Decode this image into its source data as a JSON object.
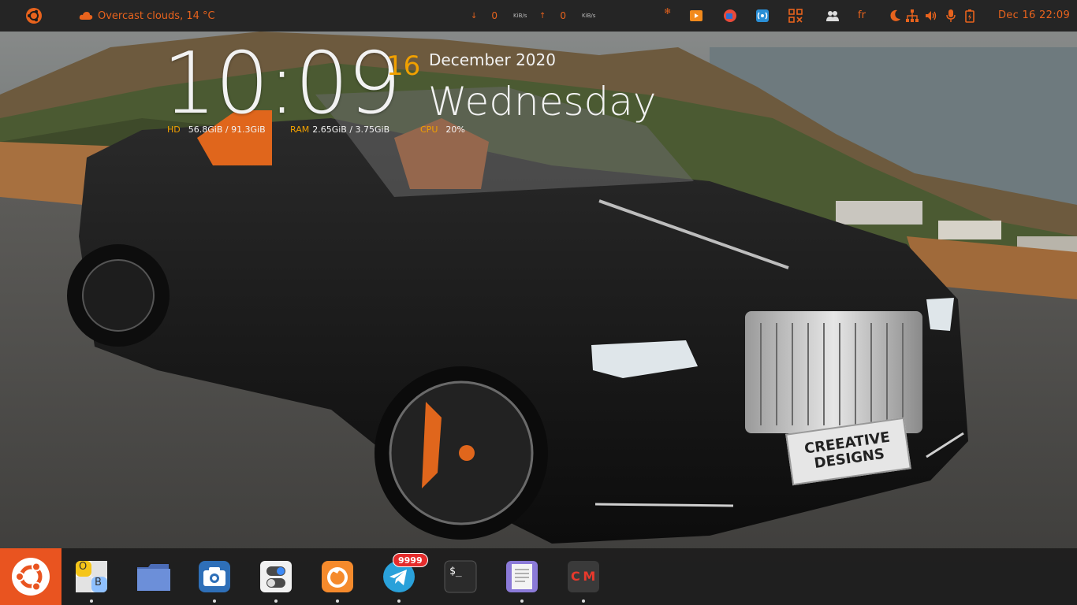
{
  "top_panel": {
    "weather_text": "Overcast clouds, 14 °C",
    "net_down_value": "0",
    "net_up_value": "0",
    "net_unit": "KiB/s",
    "language": "fr",
    "datetime": "Dec 16  22:09",
    "accent_color": "#e8631d",
    "icons": [
      "ubuntu-logo-icon",
      "weather-cloud-icon",
      "download-arrow-icon",
      "upload-arrow-icon",
      "snowflake-icon",
      "media-player-icon",
      "app-indicator-icon",
      "hotspot-icon",
      "grid-icon",
      "users-icon",
      "night-mode-icon",
      "network-icon",
      "volume-icon",
      "microphone-icon",
      "battery-icon"
    ]
  },
  "conky": {
    "time": "10:09",
    "day": "16",
    "month_year": "December 2020",
    "weekday": "Wednesday",
    "hd_label": "HD",
    "hd_value": "56.8GiB / 91.3GiB",
    "ram_label": "RAM",
    "ram_value": "2.65GiB / 3.75GiB",
    "cpu_label": "CPU",
    "cpu_value": "20%",
    "label_color": "#f0a000"
  },
  "wallpaper": {
    "plate_line1": "CREEATIVE",
    "plate_line2": "DESIGNS"
  },
  "dock": {
    "home_color": "#e95420",
    "apps": [
      {
        "name": "ob-app",
        "running": true
      },
      {
        "name": "files",
        "running": false
      },
      {
        "name": "screenshot",
        "running": true
      },
      {
        "name": "settings-toggle",
        "running": true
      },
      {
        "name": "firefox",
        "running": true
      },
      {
        "name": "telegram",
        "running": true,
        "badge": "9999"
      },
      {
        "name": "terminal",
        "running": false
      },
      {
        "name": "text-editor",
        "running": true
      },
      {
        "name": "cm-app",
        "running": true
      }
    ],
    "ob_letter_o": "O",
    "ob_letter_b": "B",
    "terminal_prompt": "$_",
    "cm_text": "C M"
  }
}
